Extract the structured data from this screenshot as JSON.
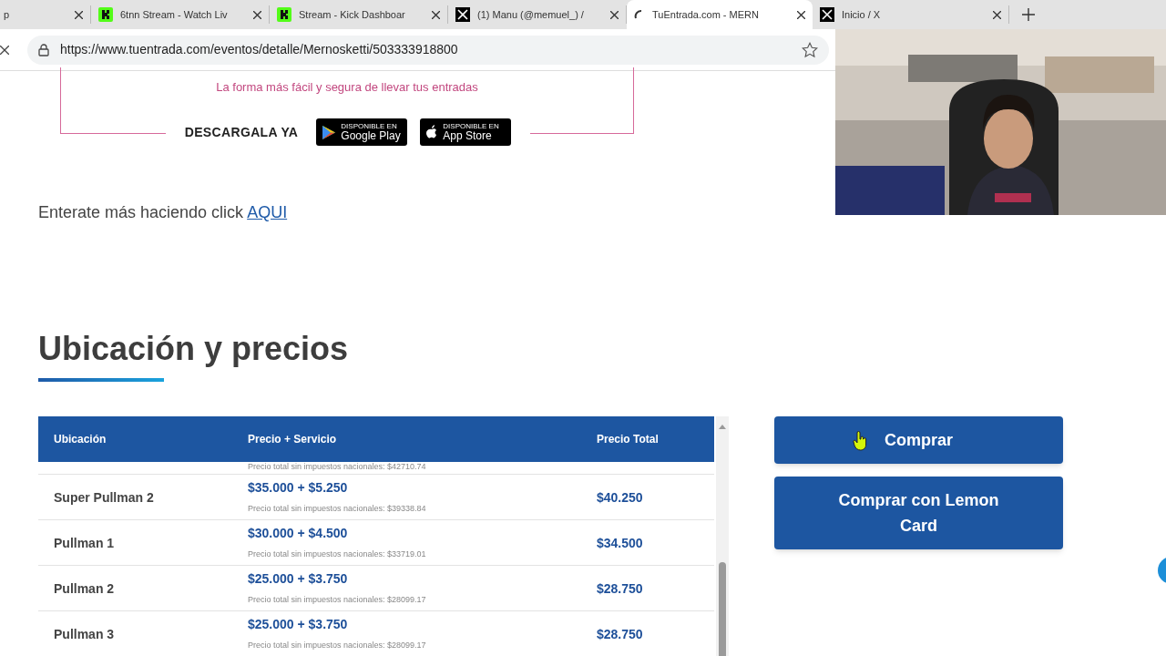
{
  "browser": {
    "tabs": [
      {
        "title": "p",
        "kind": "plain",
        "selected": false
      },
      {
        "title": "6tnn Stream - Watch Liv",
        "kind": "kick",
        "selected": false
      },
      {
        "title": "Stream - Kick Dashboar",
        "kind": "kick",
        "selected": false
      },
      {
        "title": "(1) Manu (@memuel_) /",
        "kind": "x",
        "selected": false
      },
      {
        "title": "TuEntrada.com - MERN",
        "kind": "loading",
        "selected": true
      },
      {
        "title": "Inicio / X",
        "kind": "x",
        "selected": false
      }
    ],
    "url": "https://www.tuentrada.com/eventos/detalle/Mernosketti/503333918800"
  },
  "promo": {
    "tagline": "La forma más fácil y segura de llevar tus entradas",
    "download_label": "DESCARGALA YA",
    "stores": [
      {
        "kind": "google",
        "small": "DISPONIBLE EN",
        "name": "Google Play"
      },
      {
        "kind": "apple",
        "small": "DISPONIBLE EN",
        "name": "App Store"
      }
    ]
  },
  "info": {
    "text": "Enterate más haciendo click",
    "link": "AQUI"
  },
  "section_title": "Ubicación y precios",
  "table": {
    "columns": [
      "Ubicación",
      "Precio + Servicio",
      "Precio Total"
    ],
    "partial_note": "Precio total sin impuestos nacionales: $42710.74",
    "rows": [
      {
        "name": "Super Pullman 2",
        "price": "$35.000 + $5.250",
        "note": "Precio total sin impuestos nacionales: $39338.84",
        "total": "$40.250"
      },
      {
        "name": "Pullman 1",
        "price": "$30.000 + $4.500",
        "note": "Precio total sin impuestos nacionales: $33719.01",
        "total": "$34.500"
      },
      {
        "name": "Pullman 2",
        "price": "$25.000 + $3.750",
        "note": "Precio total sin impuestos nacionales: $28099.17",
        "total": "$28.750"
      },
      {
        "name": "Pullman 3",
        "price": "$25.000 + $3.750",
        "note": "Precio total sin impuestos nacionales: $28099.17",
        "total": "$28.750"
      }
    ]
  },
  "buttons": [
    "Comprar",
    "Comprar con Lemon Card"
  ],
  "webcam": {
    "kind": "picture"
  }
}
